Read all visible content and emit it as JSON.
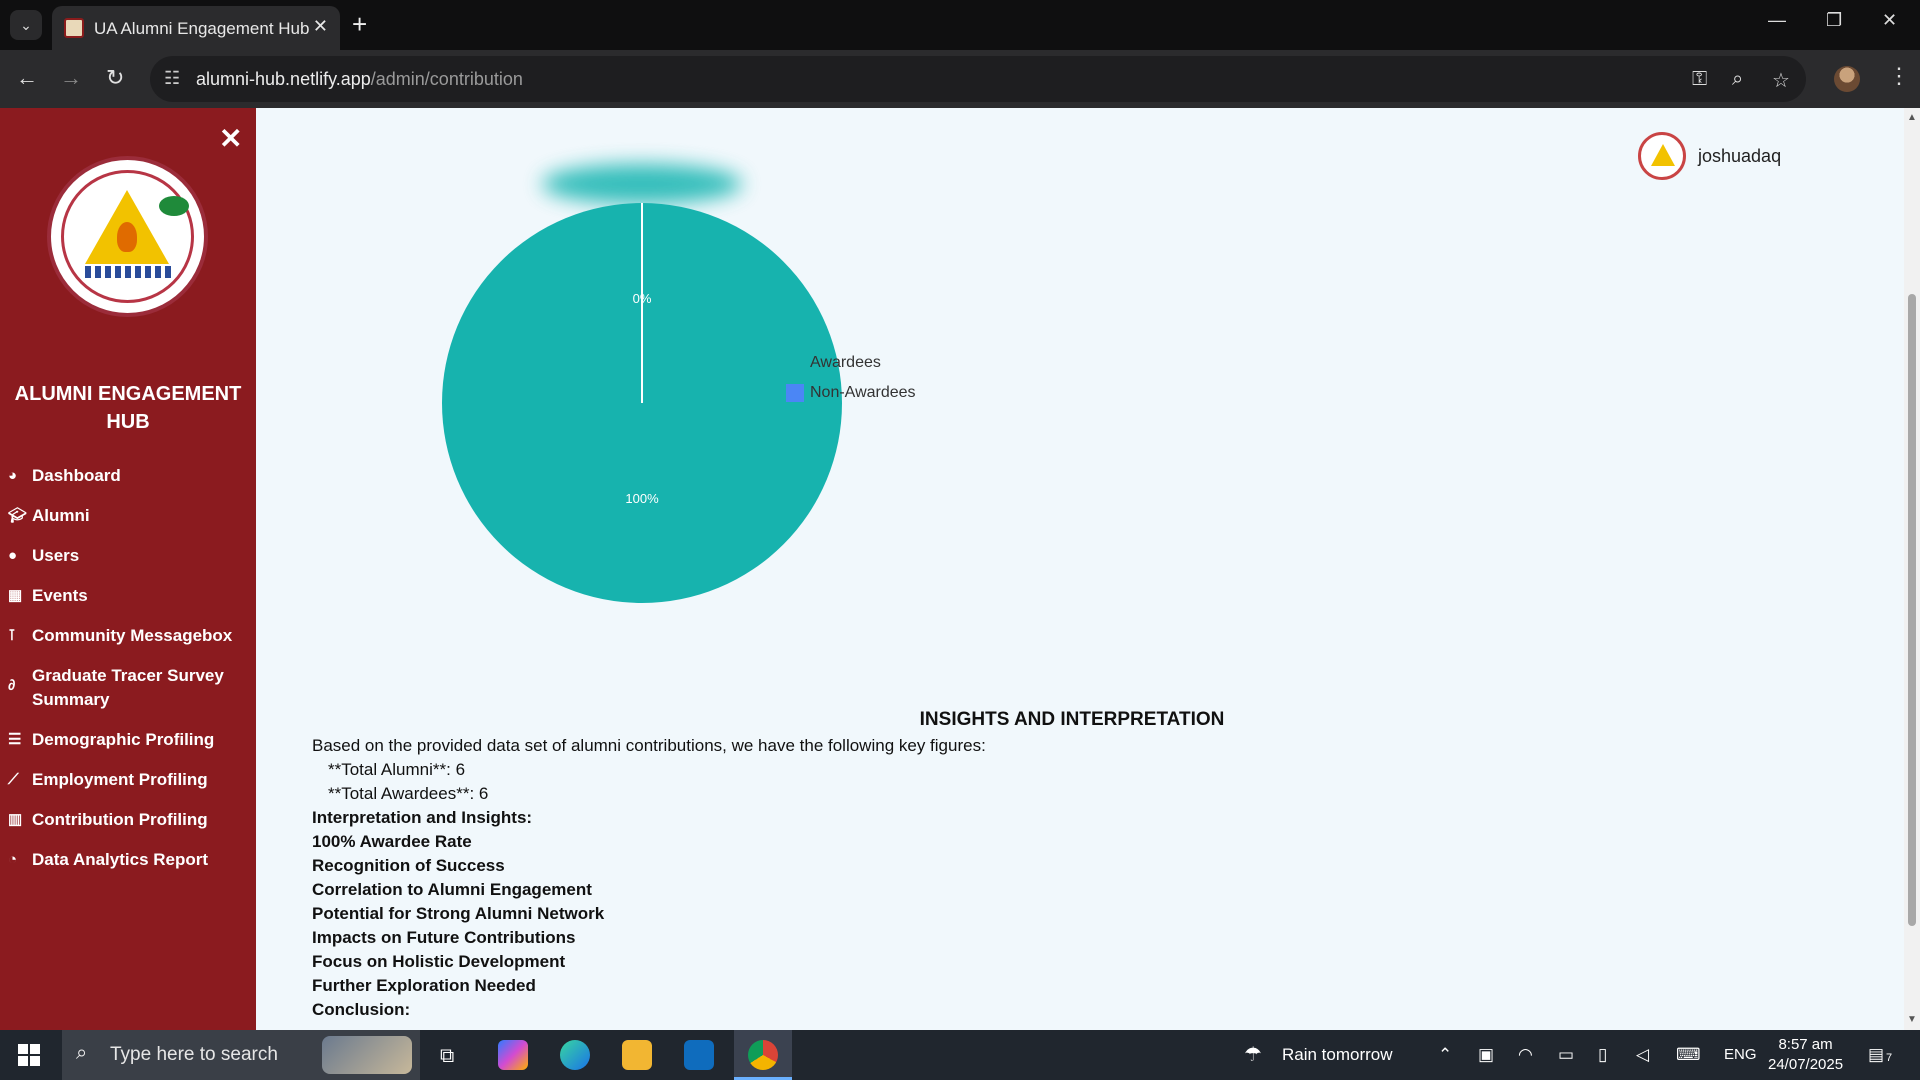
{
  "browser": {
    "tab_title": "UA Alumni Engagement Hub",
    "url_host": "alumni-hub.netlify.app",
    "url_path": "/admin/contribution"
  },
  "sidebar": {
    "title": "ALUMNI ENGAGEMENT HUB",
    "items": [
      {
        "label": "Dashboard",
        "icon": "palette-icon"
      },
      {
        "label": "Alumni",
        "icon": "graduation-cap-icon"
      },
      {
        "label": "Users",
        "icon": "user-icon"
      },
      {
        "label": "Events",
        "icon": "calendar-icon"
      },
      {
        "label": "Community Messagebox",
        "icon": "broadcast-icon"
      },
      {
        "label": "Graduate Tracer Survey Summary",
        "icon": "paperclip-icon"
      },
      {
        "label": "Demographic Profiling",
        "icon": "list-chart-icon"
      },
      {
        "label": "Employment Profiling",
        "icon": "line-chart-icon"
      },
      {
        "label": "Contribution Profiling",
        "icon": "bar-chart-icon"
      },
      {
        "label": "Data Analytics Report",
        "icon": "pie-chart-icon"
      }
    ]
  },
  "header": {
    "username": "joshuadaq"
  },
  "chart_data": {
    "type": "pie",
    "categories": [
      "Awardees",
      "Non-Awardees"
    ],
    "values": [
      100,
      0
    ],
    "labels": [
      "100%",
      "0%"
    ],
    "colors": [
      "#17b3ae",
      "#4b86f5"
    ],
    "legend": "right"
  },
  "insights": {
    "heading": "INSIGHTS AND INTERPRETATION",
    "intro": "Based on the provided data set of alumni contributions, we have the following key figures:",
    "figures": [
      "**Total Alumni**: 6",
      "**Total Awardees**: 6"
    ],
    "points": [
      "Interpretation and Insights:",
      "100% Awardee Rate",
      "Recognition of Success",
      "Correlation to Alumni Engagement",
      "Potential for Strong Alumni Network",
      "Impacts on Future Contributions",
      "Focus on Holistic Development",
      "Further Exploration Needed",
      "Conclusion:"
    ]
  },
  "taskbar": {
    "search_placeholder": "Type here to search",
    "weather": "Rain tomorrow",
    "language": "ENG",
    "time": "8:57 am",
    "date": "24/07/2025",
    "notification_count": "7"
  }
}
